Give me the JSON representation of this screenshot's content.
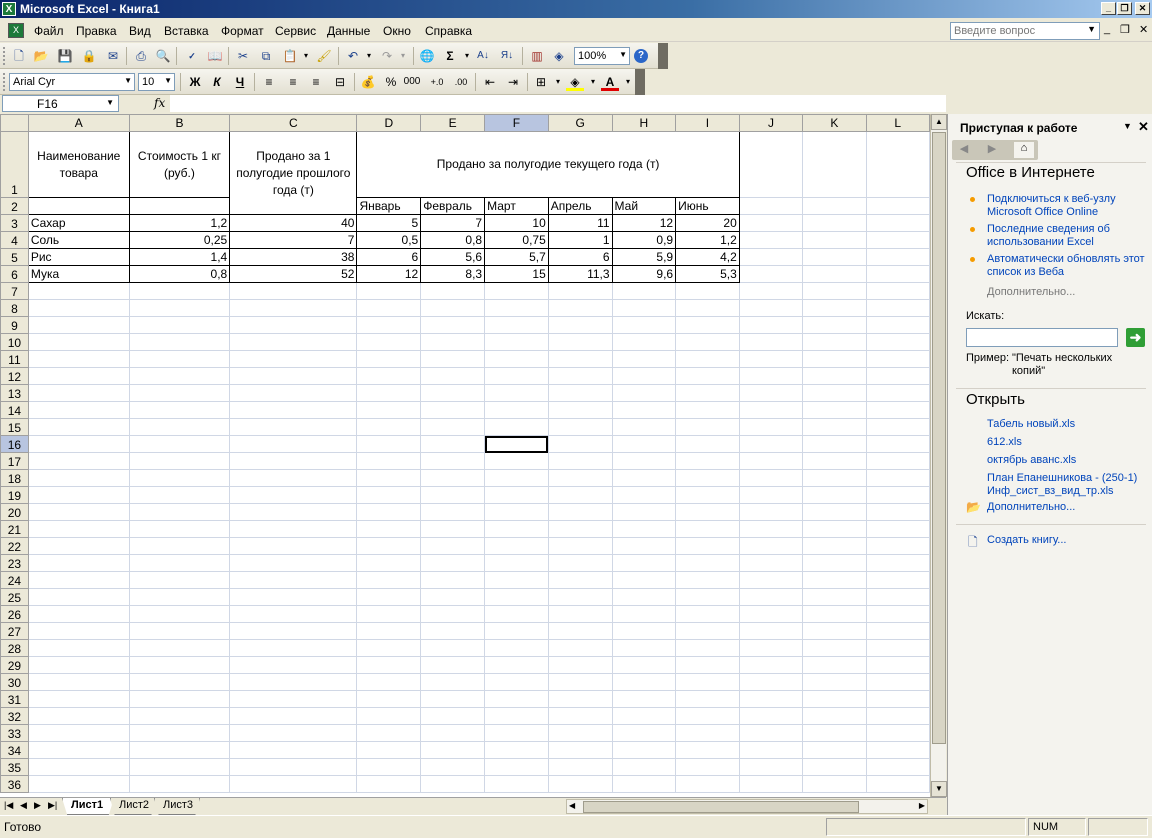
{
  "window": {
    "title": "Microsoft Excel - Книга1"
  },
  "menu": {
    "items": [
      "Файл",
      "Правка",
      "Вид",
      "Вставка",
      "Формат",
      "Сервис",
      "Данные",
      "Окно",
      "Справка"
    ],
    "help_placeholder": "Введите вопрос"
  },
  "toolbar": {
    "zoom": "100%",
    "font_name": "Arial Cyr",
    "font_size": "10",
    "bold": "Ж",
    "italic": "К",
    "underline": "Ч",
    "percent": "%",
    "thousands": "000"
  },
  "formula_bar": {
    "name_box": "F16",
    "fx": "fx",
    "content": ""
  },
  "sheet": {
    "columns": [
      "A",
      "B",
      "C",
      "D",
      "E",
      "F",
      "G",
      "H",
      "I",
      "J",
      "K",
      "L"
    ],
    "rows": [
      "1",
      "2",
      "3",
      "4",
      "5",
      "6",
      "7",
      "8",
      "9",
      "10",
      "11",
      "12",
      "13",
      "14",
      "15",
      "16",
      "17",
      "18",
      "19",
      "20",
      "21",
      "22",
      "23",
      "24",
      "25",
      "26",
      "27",
      "28",
      "29",
      "30",
      "31",
      "32",
      "33",
      "34",
      "35",
      "36"
    ],
    "header": {
      "a1": "Наименование товара",
      "b1": "Стоимость 1 кг (руб.)",
      "c1": "Продано за 1 полугодие прошлого года (т)",
      "d1": "Продано за полугодие текущего года (т)",
      "months": [
        "Январь",
        "Февраль",
        "Март",
        "Апрель",
        "Май",
        "Июнь"
      ]
    },
    "data_rows": [
      {
        "name": "Сахар",
        "price": "1,2",
        "last_year": "40",
        "months": [
          "5",
          "7",
          "10",
          "11",
          "12",
          "20"
        ]
      },
      {
        "name": "Соль",
        "price": "0,25",
        "last_year": "7",
        "months": [
          "0,5",
          "0,8",
          "0,75",
          "1",
          "0,9",
          "1,2"
        ]
      },
      {
        "name": "Рис",
        "price": "1,4",
        "last_year": "38",
        "months": [
          "6",
          "5,6",
          "5,7",
          "6",
          "5,9",
          "4,2"
        ]
      },
      {
        "name": "Мука",
        "price": "0,8",
        "last_year": "52",
        "months": [
          "12",
          "8,3",
          "15",
          "11,3",
          "9,6",
          "5,3"
        ]
      }
    ],
    "tabs": [
      "Лист1",
      "Лист2",
      "Лист3"
    ]
  },
  "status": {
    "text": "Готово",
    "num": "NUM"
  },
  "task_pane": {
    "title": "Приступая к работе",
    "online_section": "Office в Интернете",
    "online_links": [
      "Подключиться к веб-узлу Microsoft Office Online",
      "Последние сведения об использовании Excel",
      "Автоматически обновлять этот список из Веба"
    ],
    "more_online": "Дополнительно...",
    "search_label": "Искать:",
    "example_prefix": "Пример:",
    "example_text": "\"Печать нескольких копий\"",
    "open_section": "Открыть",
    "files": [
      "Табель новый.xls",
      "612.xls",
      "октябрь аванс.xls",
      "План Епанешникова - (250-1) Инф_сист_вз_вид_тр.xls"
    ],
    "more_files": "Дополнительно...",
    "create": "Создать книгу..."
  },
  "icons": [
    "new-icon",
    "open-icon",
    "save-icon",
    "permission-icon",
    "email-icon",
    "print-icon",
    "print-preview-icon",
    "spelling-icon",
    "research-icon",
    "cut-icon",
    "copy-icon",
    "paste-icon",
    "format-painter-icon",
    "undo-icon",
    "redo-icon",
    "hyperlink-icon",
    "autosum-icon",
    "sort-asc-icon",
    "sort-desc-icon",
    "chart-icon",
    "drawing-icon",
    "help-icon"
  ],
  "colors": {
    "title_bar": "#0a246a",
    "accent_link": "#0044bb",
    "bullet": "#f59b00",
    "go_button": "#2f9e35",
    "selected_header": "#b8c5e0"
  }
}
